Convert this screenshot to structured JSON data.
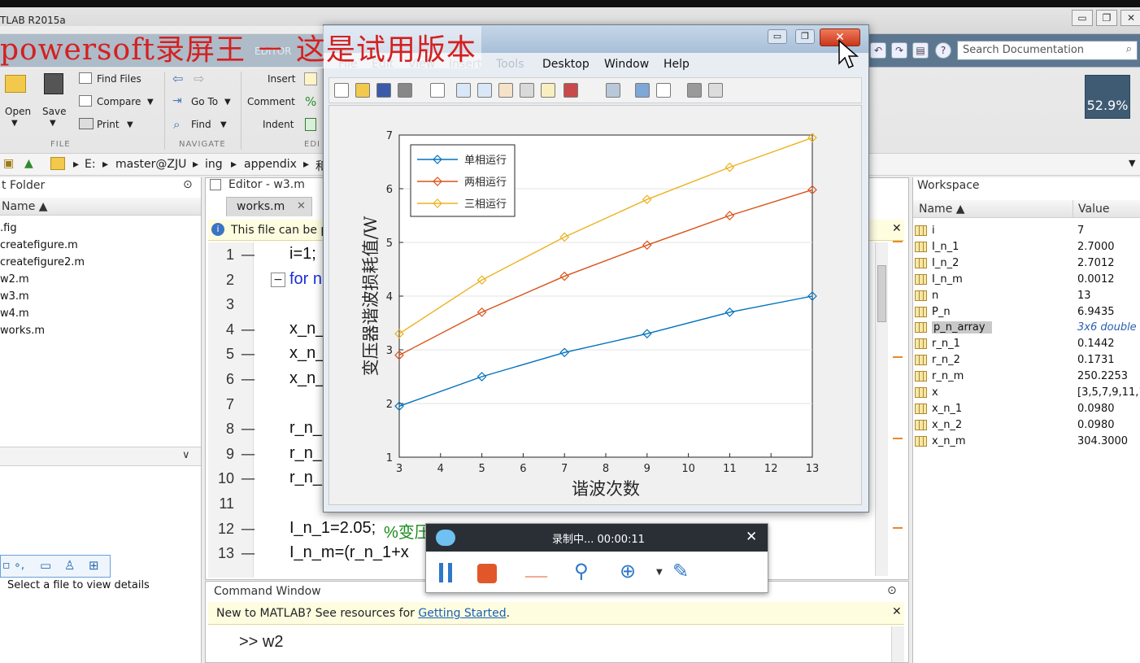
{
  "app": {
    "title": "TLAB R2015a",
    "watermark": "powersoft录屏王 － 这是试用版本",
    "window_buttons": [
      "▭",
      "❐",
      "✕"
    ]
  },
  "ribbon": {
    "tab_editor": "EDITOR",
    "file": {
      "open": "Open",
      "save": "Save",
      "find_files": "Find Files",
      "compare": "Compare",
      "print": "Print",
      "section": "FILE"
    },
    "navigate": {
      "go_to": "Go To",
      "find": "Find",
      "section": "NAVIGATE"
    },
    "edit": {
      "insert": "Insert",
      "comment": "Comment",
      "indent": "Indent",
      "section": "EDI"
    },
    "search_placeholder": "Search Documentation",
    "cpu_usage": "52.9%"
  },
  "address": {
    "crumbs": [
      "E:",
      "master@ZJU",
      "ing",
      "appendix",
      "和"
    ]
  },
  "folder_panel": {
    "title": "t Folder",
    "col_name": "Name ▲",
    "files": [
      ".fig",
      "createfigure.m",
      "createfigure2.m",
      "w2.m",
      "w3.m",
      "w4.m",
      "works.m"
    ],
    "details_hint": "Select a file to view details"
  },
  "editor": {
    "title": "Editor - w3.m",
    "tab": "works.m",
    "notice": "This file can be p",
    "lines": [
      {
        "no": "1",
        "dash": "—",
        "code": "i=1;"
      },
      {
        "no": "2",
        "dash": "",
        "code": "for n"
      },
      {
        "no": "3",
        "dash": "",
        "code": ""
      },
      {
        "no": "4",
        "dash": "—",
        "code": "x_n_"
      },
      {
        "no": "5",
        "dash": "—",
        "code": "x_n_"
      },
      {
        "no": "6",
        "dash": "—",
        "code": "x_n_"
      },
      {
        "no": "7",
        "dash": "",
        "code": ""
      },
      {
        "no": "8",
        "dash": "—",
        "code": "r_n_"
      },
      {
        "no": "9",
        "dash": "—",
        "code": "r_n_"
      },
      {
        "no": "10",
        "dash": "—",
        "code": "r_n_"
      },
      {
        "no": "11",
        "dash": "",
        "code": ""
      },
      {
        "no": "12",
        "dash": "—",
        "code": "I_n_1=2.05;"
      },
      {
        "no": "13",
        "dash": "—",
        "code": "I_n_m=(r_n_1+x"
      }
    ],
    "comment_fragment": "%变压"
  },
  "command_window": {
    "title": "Command Window",
    "notice_text": "New to MATLAB? See resources for ",
    "notice_link": "Getting Started",
    "notice_end": ".",
    "prompt": ">> w2"
  },
  "workspace": {
    "title": "Workspace",
    "col_name": "Name ▲",
    "col_value": "Value",
    "vars": [
      {
        "name": "i",
        "value": "7"
      },
      {
        "name": "I_n_1",
        "value": "2.7000"
      },
      {
        "name": "I_n_2",
        "value": "2.7012"
      },
      {
        "name": "I_n_m",
        "value": "0.0012"
      },
      {
        "name": "n",
        "value": "13"
      },
      {
        "name": "P_n",
        "value": "6.9435"
      },
      {
        "name": "p_n_array",
        "value": "3x6 double"
      },
      {
        "name": "r_n_1",
        "value": "0.1442"
      },
      {
        "name": "r_n_2",
        "value": "0.1731"
      },
      {
        "name": "r_n_m",
        "value": "250.2253"
      },
      {
        "name": "x",
        "value": "[3,5,7,9,11,1"
      },
      {
        "name": "x_n_1",
        "value": "0.0980"
      },
      {
        "name": "x_n_2",
        "value": "0.0980"
      },
      {
        "name": "x_n_m",
        "value": "304.3000"
      }
    ]
  },
  "figure": {
    "menus": [
      "File",
      "Edit",
      "View",
      "Insert",
      "Tools",
      "Desktop",
      "Window",
      "Help"
    ],
    "close_label": "✕"
  },
  "chart_data": {
    "type": "line",
    "x": [
      3,
      5,
      7,
      9,
      11,
      13
    ],
    "series": [
      {
        "name": "单相运行",
        "values": [
          1.95,
          2.5,
          2.95,
          3.3,
          3.7,
          4.0
        ],
        "color": "#0072BD"
      },
      {
        "name": "两相运行",
        "values": [
          2.9,
          3.7,
          4.37,
          4.95,
          5.5,
          5.98
        ],
        "color": "#D95319"
      },
      {
        "name": "三相运行",
        "values": [
          3.3,
          4.3,
          5.1,
          5.8,
          6.4,
          6.95
        ],
        "color": "#EDB120"
      }
    ],
    "xlabel": "谐波次数",
    "ylabel": "变压器谐波损耗值/W",
    "xlim": [
      3,
      13
    ],
    "ylim": [
      1,
      7
    ],
    "xticks": [
      "3",
      "4",
      "5",
      "6",
      "7",
      "8",
      "9",
      "10",
      "11",
      "12",
      "13"
    ],
    "yticks": [
      "1",
      "2",
      "3",
      "4",
      "5",
      "6",
      "7"
    ],
    "grid": "horizontal",
    "legend": "top-left"
  },
  "recorder": {
    "status": "录制中... 00:00:11",
    "close": "✕"
  }
}
